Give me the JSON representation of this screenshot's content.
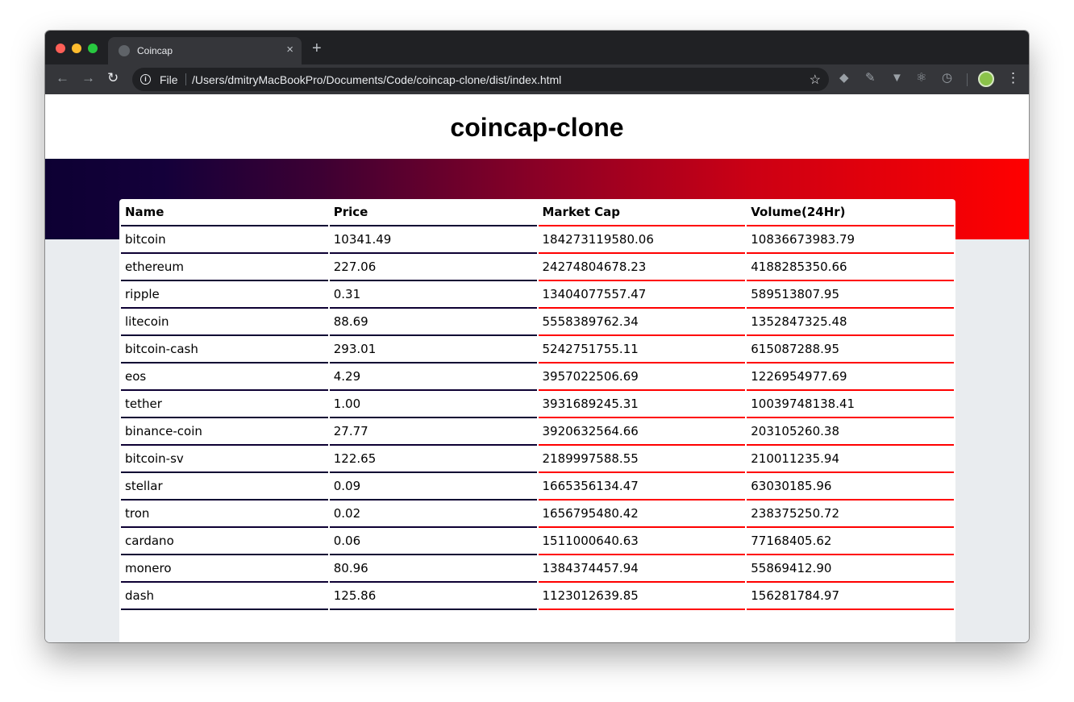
{
  "browser": {
    "tab_title": "Coincap",
    "tab_close": "×",
    "new_tab": "+",
    "scheme_label": "File",
    "url": "/Users/dmitryMacBookPro/Documents/Code/coincap-clone/dist/index.html"
  },
  "page": {
    "title": "coincap-clone"
  },
  "table": {
    "headers": [
      "Name",
      "Price",
      "Market Cap",
      "Volume(24Hr)"
    ],
    "rows": [
      [
        "bitcoin",
        "10341.49",
        "184273119580.06",
        "10836673983.79"
      ],
      [
        "ethereum",
        "227.06",
        "24274804678.23",
        "4188285350.66"
      ],
      [
        "ripple",
        "0.31",
        "13404077557.47",
        "589513807.95"
      ],
      [
        "litecoin",
        "88.69",
        "5558389762.34",
        "1352847325.48"
      ],
      [
        "bitcoin-cash",
        "293.01",
        "5242751755.11",
        "615087288.95"
      ],
      [
        "eos",
        "4.29",
        "3957022506.69",
        "1226954977.69"
      ],
      [
        "tether",
        "1.00",
        "3931689245.31",
        "10039748138.41"
      ],
      [
        "binance-coin",
        "27.77",
        "3920632564.66",
        "203105260.38"
      ],
      [
        "bitcoin-sv",
        "122.65",
        "2189997588.55",
        "210011235.94"
      ],
      [
        "stellar",
        "0.09",
        "1665356134.47",
        "63030185.96"
      ],
      [
        "tron",
        "0.02",
        "1656795480.42",
        "238375250.72"
      ],
      [
        "cardano",
        "0.06",
        "1511000640.63",
        "77168405.62"
      ],
      [
        "monero",
        "80.96",
        "1384374457.94",
        "55869412.90"
      ],
      [
        "dash",
        "125.86",
        "1123012639.85",
        "156281784.97"
      ]
    ]
  },
  "colors": {
    "banner_start": "#0d0033",
    "banner_end": "#ff0000",
    "border_dark": "#0d0033",
    "border_red": "#ff0000"
  },
  "icons": {
    "back": "arrow-left-icon",
    "forward": "arrow-right-icon",
    "reload": "reload-icon",
    "info": "info-icon",
    "star": "star-icon",
    "menu": "more-vert-icon"
  }
}
